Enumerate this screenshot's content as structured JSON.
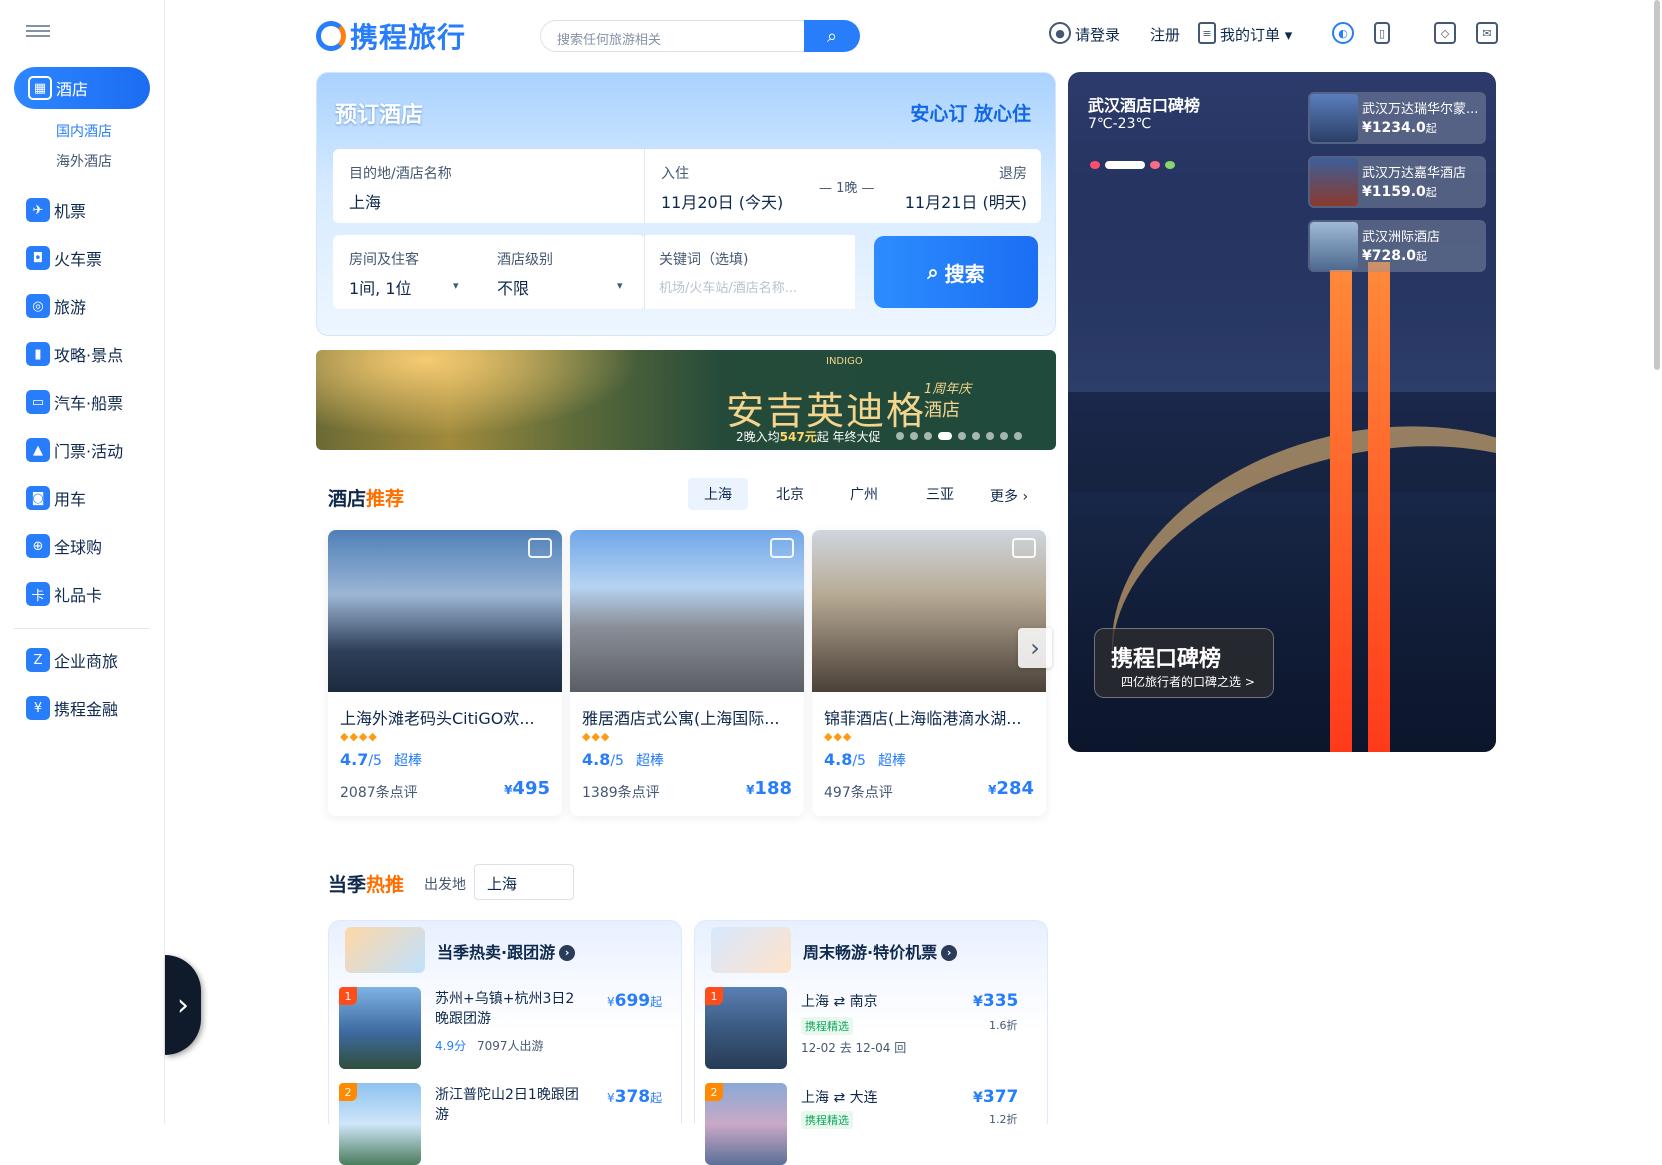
{
  "header": {
    "logo": "携程旅行",
    "search_placeholder": "搜索任何旅游相关",
    "links": [
      "请登录",
      "注册",
      "我的订单"
    ]
  },
  "sidebar": {
    "items": [
      {
        "label": "酒店",
        "icon": "hotel-icon",
        "active": true
      },
      {
        "label": "机票",
        "icon": "plane-icon"
      },
      {
        "label": "火车票",
        "icon": "train-icon"
      },
      {
        "label": "旅游",
        "icon": "travel-icon"
      },
      {
        "label": "攻略·景点",
        "icon": "guide-icon"
      },
      {
        "label": "汽车·船票",
        "icon": "bus-icon"
      },
      {
        "label": "门票·活动",
        "icon": "ticket-icon"
      },
      {
        "label": "用车",
        "icon": "car-icon"
      },
      {
        "label": "全球购",
        "icon": "shopping-icon"
      },
      {
        "label": "礼品卡",
        "icon": "gift-card-icon"
      },
      {
        "label": "企业商旅",
        "icon": "business-icon"
      },
      {
        "label": "携程金融",
        "icon": "finance-icon"
      }
    ],
    "sub_items": [
      "国内酒店",
      "海外酒店"
    ]
  },
  "booking": {
    "title": "预订酒店",
    "slogan": "安心订 放心住",
    "destination_label": "目的地/酒店名称",
    "destination_value": "上海",
    "checkin_label": "入住",
    "checkin_value": "11月20日 (今天)",
    "nights": "1晚",
    "checkout_label": "退房",
    "checkout_value": "11月21日 (明天)",
    "rooms_label": "房间及住客",
    "rooms_value": "1间, 1位",
    "level_label": "酒店级别",
    "level_value": "不限",
    "keyword_label": "关键词（选填)",
    "keyword_placeholder": "机场/火车站/酒店名称...",
    "search_button": "搜索"
  },
  "banner": {
    "title": "安吉英迪格",
    "title_suffix": "酒店",
    "tag": "1周年庆",
    "brand": "INDIGO",
    "subtitle_prefix": "2晚入均",
    "subtitle_price": "547元",
    "subtitle_suffix": "起 年终大促"
  },
  "recommend": {
    "title_a": "酒店",
    "title_b": "推荐",
    "cities": [
      "上海",
      "北京",
      "广州",
      "三亚"
    ],
    "more": "更多",
    "hotels": [
      {
        "name": "上海外滩老码头CitiGO欢...",
        "score": "4.7",
        "score_max": "/5",
        "tag": "超棒",
        "reviews": "2087条点评",
        "price": "495",
        "stars": "◆◆◆◆"
      },
      {
        "name": "雅居酒店式公寓(上海国际...",
        "score": "4.8",
        "score_max": "/5",
        "tag": "超棒",
        "reviews": "1389条点评",
        "price": "188",
        "stars": "◆◆◆"
      },
      {
        "name": "锦菲酒店(上海临港滴水湖...",
        "score": "4.8",
        "score_max": "/5",
        "tag": "超棒",
        "reviews": "497条点评",
        "price": "284",
        "stars": "◆◆◆"
      }
    ]
  },
  "season": {
    "title_a": "当季",
    "title_b": "热推",
    "departure_label": "出发地",
    "departure_value": "上海",
    "tour_panel": {
      "title": "当季热卖·跟团游",
      "items": [
        {
          "rank": "1",
          "name": "苏州+乌镇+杭州3日2晚跟团游",
          "price": "699",
          "price_suffix": "起",
          "score": "4.9分",
          "count": "7097人出游"
        },
        {
          "rank": "2",
          "name": "浙江普陀山2日1晚跟团游",
          "price": "378",
          "price_suffix": "起"
        }
      ]
    },
    "flight_panel": {
      "title": "周末畅游·特价机票",
      "items": [
        {
          "rank": "1",
          "from": "上海",
          "to": "南京",
          "tag": "携程精选",
          "date_out": "12-02",
          "date_back": "12-04",
          "out_label": "去",
          "back_label": "回",
          "price": "335",
          "discount": "1.6折"
        },
        {
          "rank": "2",
          "from": "上海",
          "to": "大连",
          "tag": "携程精选",
          "price": "377",
          "discount": "1.2折"
        }
      ]
    }
  },
  "hero": {
    "title": "武汉酒店口碑榜",
    "weather": "7℃-23℃",
    "badge_title": "携程口碑榜",
    "badge_sub": "四亿旅行者的口碑之选 >",
    "rankings": [
      {
        "name": "武汉万达瑞华尔蒙...",
        "price": "1234.0",
        "suffix": "起"
      },
      {
        "name": "武汉万达嘉华酒店",
        "price": "1159.0",
        "suffix": "起"
      },
      {
        "name": "武汉洲际酒店",
        "price": "728.0",
        "suffix": "起"
      }
    ]
  },
  "colors": {
    "brand": "#287dfa",
    "accent": "#ff6f00",
    "dark": "#0f294d"
  }
}
